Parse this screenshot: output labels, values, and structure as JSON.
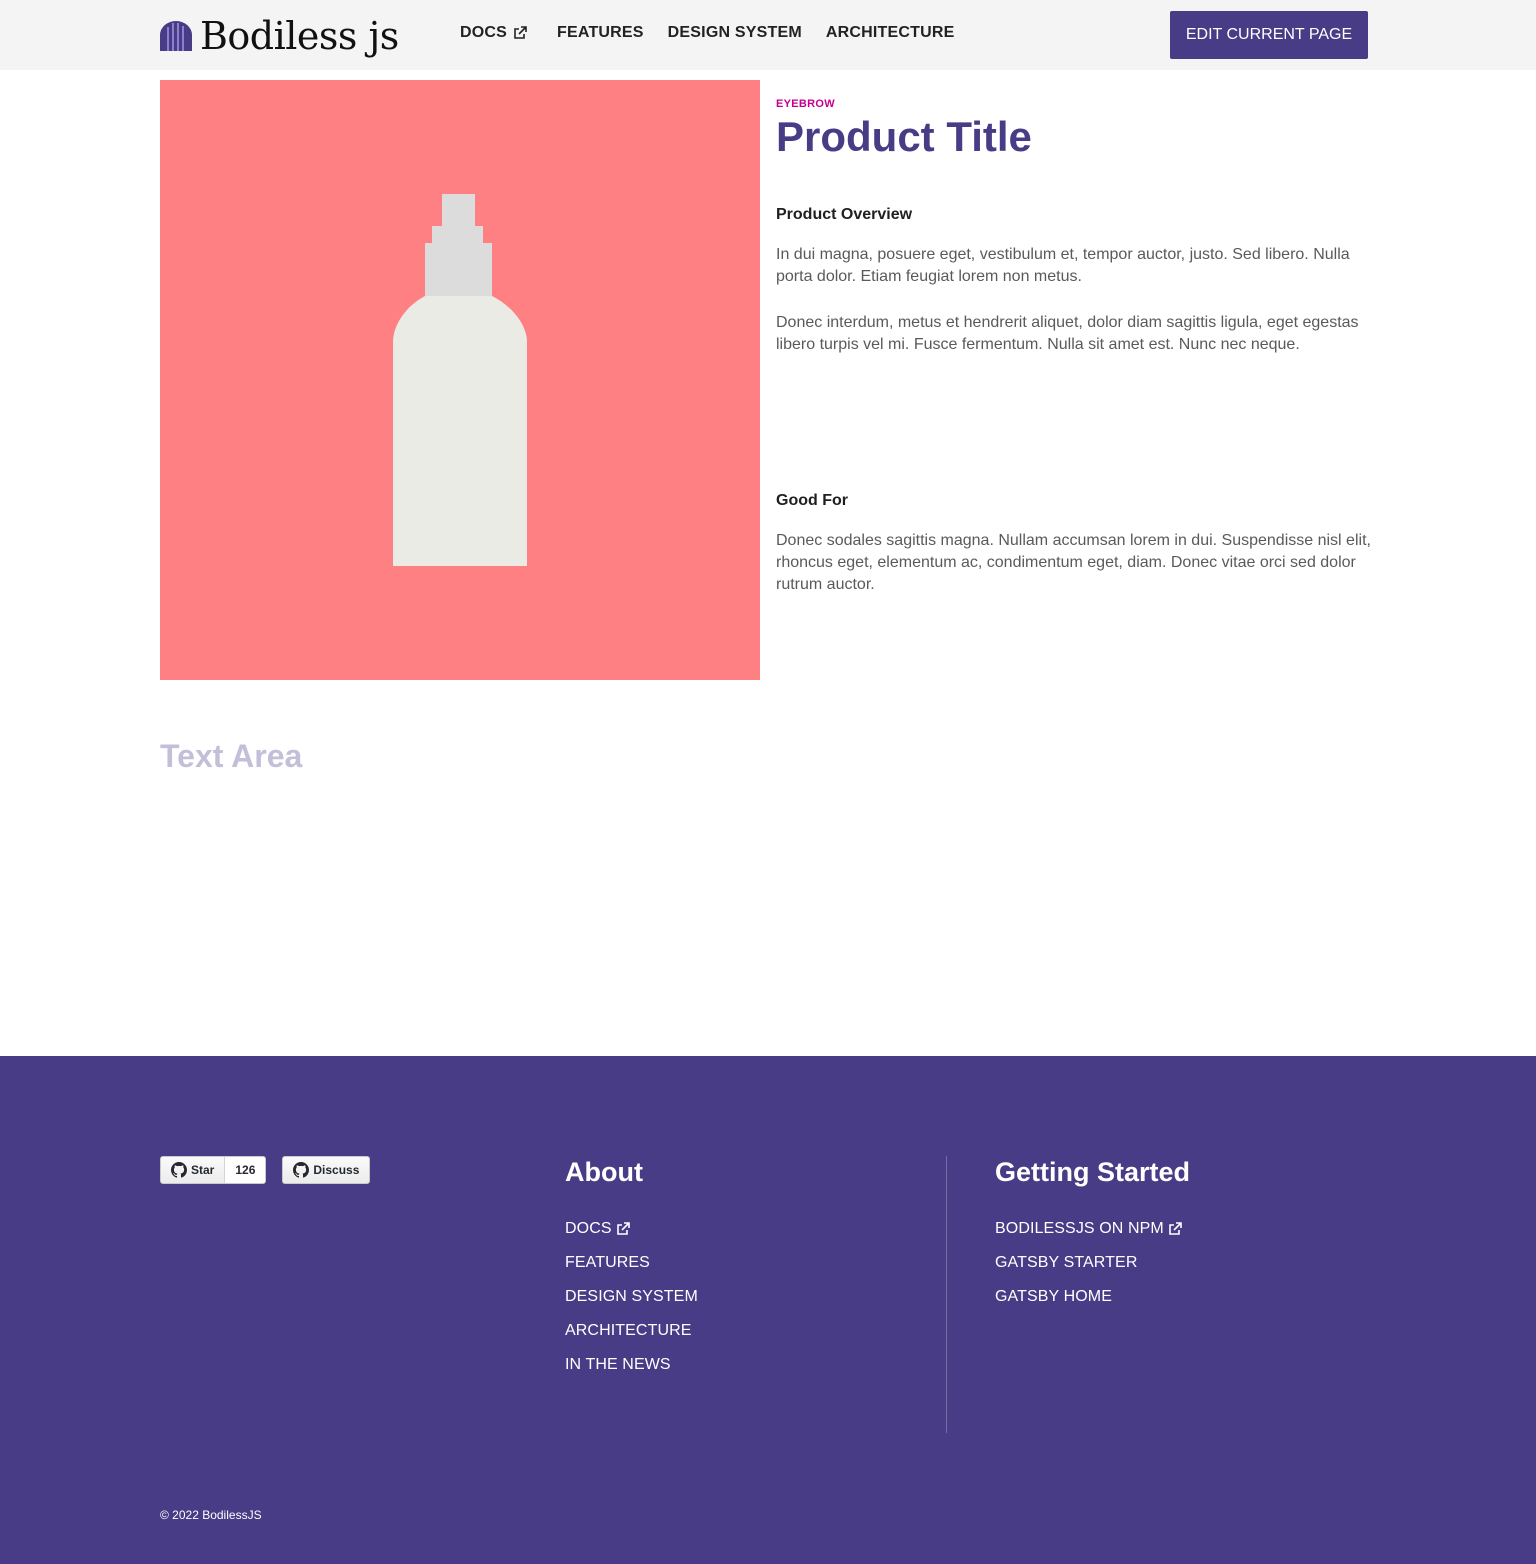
{
  "header": {
    "logo_text": "Bodiless js",
    "nav": [
      {
        "label": "DOCS",
        "external": true
      },
      {
        "label": "FEATURES",
        "external": false
      },
      {
        "label": "DESIGN SYSTEM",
        "external": false
      },
      {
        "label": "ARCHITECTURE",
        "external": false
      }
    ],
    "edit_button": "EDIT CURRENT PAGE"
  },
  "product": {
    "eyebrow": "EYEBROW",
    "title": "Product Title",
    "overview_heading": "Product Overview",
    "overview_p1": "In dui magna, posuere eget, vestibulum et, tempor auctor, justo. Sed libero. Nulla porta dolor. Etiam feugiat lorem non metus.",
    "overview_p2": "Donec interdum, metus et hendrerit aliquet, dolor diam sagittis ligula, eget egestas libero turpis vel mi. Fusce fermentum. Nulla sit amet est. Nunc nec neque.",
    "goodfor_heading": "Good For",
    "goodfor_p": "Donec sodales sagittis magna. Nullam accumsan lorem in dui. Suspendisse nisl elit, rhoncus eget, elementum ac, condimentum eget, diam. Donec vitae orci sed dolor rutrum auctor."
  },
  "text_area_title": "Text Area",
  "footer": {
    "github": {
      "star_label": "Star",
      "star_count": "126",
      "discuss_label": "Discuss"
    },
    "about": {
      "heading": "About",
      "links": [
        {
          "label": "DOCS",
          "external": true
        },
        {
          "label": "FEATURES"
        },
        {
          "label": "DESIGN SYSTEM"
        },
        {
          "label": "ARCHITECTURE"
        },
        {
          "label": "IN THE NEWS"
        }
      ]
    },
    "getting_started": {
      "heading": "Getting Started",
      "links": [
        {
          "label": "BODILESSJS ON NPM",
          "external": true
        },
        {
          "label": "GATSBY STARTER"
        },
        {
          "label": "GATSBY HOME"
        }
      ]
    },
    "copyright": "© 2022 BodilessJS"
  },
  "colors": {
    "brand_purple": "#473c85",
    "eyebrow_magenta": "#c4008e",
    "hero_background": "#ff8083",
    "header_background": "#f4f4f4",
    "text_area_title": "#c3bfd9"
  },
  "icons": {
    "external_link": "external-link-icon",
    "github": "github-icon",
    "logo": "bodiless-logo-icon",
    "product": "spray-bottle-icon"
  }
}
